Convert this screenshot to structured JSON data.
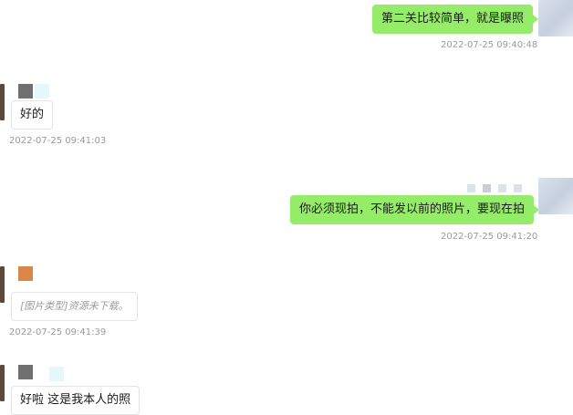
{
  "chat": {
    "messages": [
      {
        "side": "right",
        "text": "第二关比较简单，就是曝照",
        "time": "2022-07-25 09:40:48"
      },
      {
        "side": "left",
        "text": "好的",
        "time": "2022-07-25 09:41:03"
      },
      {
        "side": "right",
        "text": "你必须现拍，不能发以前的照片，要现在拍",
        "time": "2022-07-25 09:41:20"
      },
      {
        "side": "left",
        "text": "[图片类型]资源未下载。",
        "time": "2022-07-25 09:41:39"
      },
      {
        "side": "left",
        "text": "好啦 这是我本人的照",
        "time": ""
      }
    ]
  },
  "colors": {
    "outgoing_bubble": "#95ec69",
    "incoming_bubble": "#ffffff",
    "timestamp": "#9a9a9a"
  }
}
